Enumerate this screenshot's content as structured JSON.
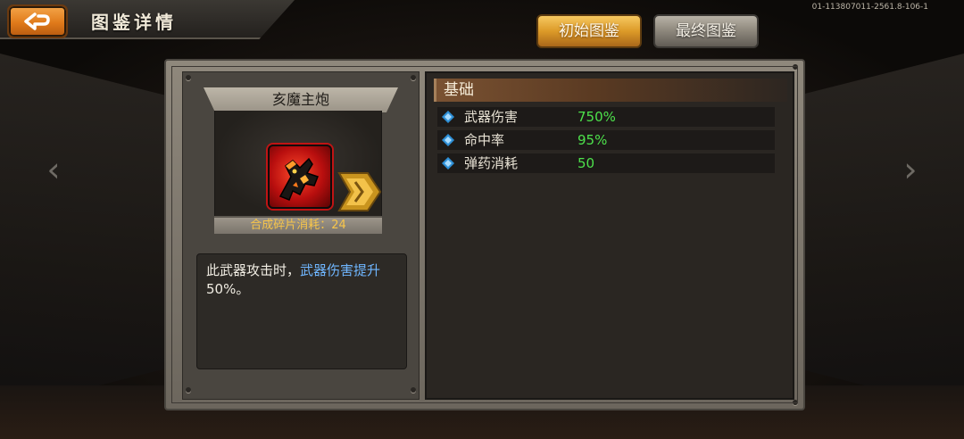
{
  "header": {
    "title": "图鉴详情",
    "version": "01-113807011-2561.8-106-1"
  },
  "tabs": {
    "initial_label": "初始图鉴",
    "final_label": "最终图鉴"
  },
  "weapon": {
    "name": "亥魔主炮",
    "cost_label": "合成碎片消耗：",
    "cost_value": "24",
    "description_part1": "此武器攻击时，",
    "description_highlight": "武器伤害提升",
    "description_part2": "50%。"
  },
  "stats": {
    "section_title": "基础",
    "rows": [
      {
        "label": "武器伤害",
        "value": "750%"
      },
      {
        "label": "命中率",
        "value": "95%"
      },
      {
        "label": "弹药消耗",
        "value": "50"
      }
    ]
  },
  "colors": {
    "stat_value": "#4de14b",
    "highlight_text": "#6fb6ff",
    "cost_text": "#f7c54a",
    "active_tab": "#dc9a28"
  },
  "icons": {
    "back": "back-arrow-icon",
    "weapon": "beast-cannon-icon",
    "next": "chevron-right-icon",
    "bullet": "diamond-bullet-icon"
  }
}
